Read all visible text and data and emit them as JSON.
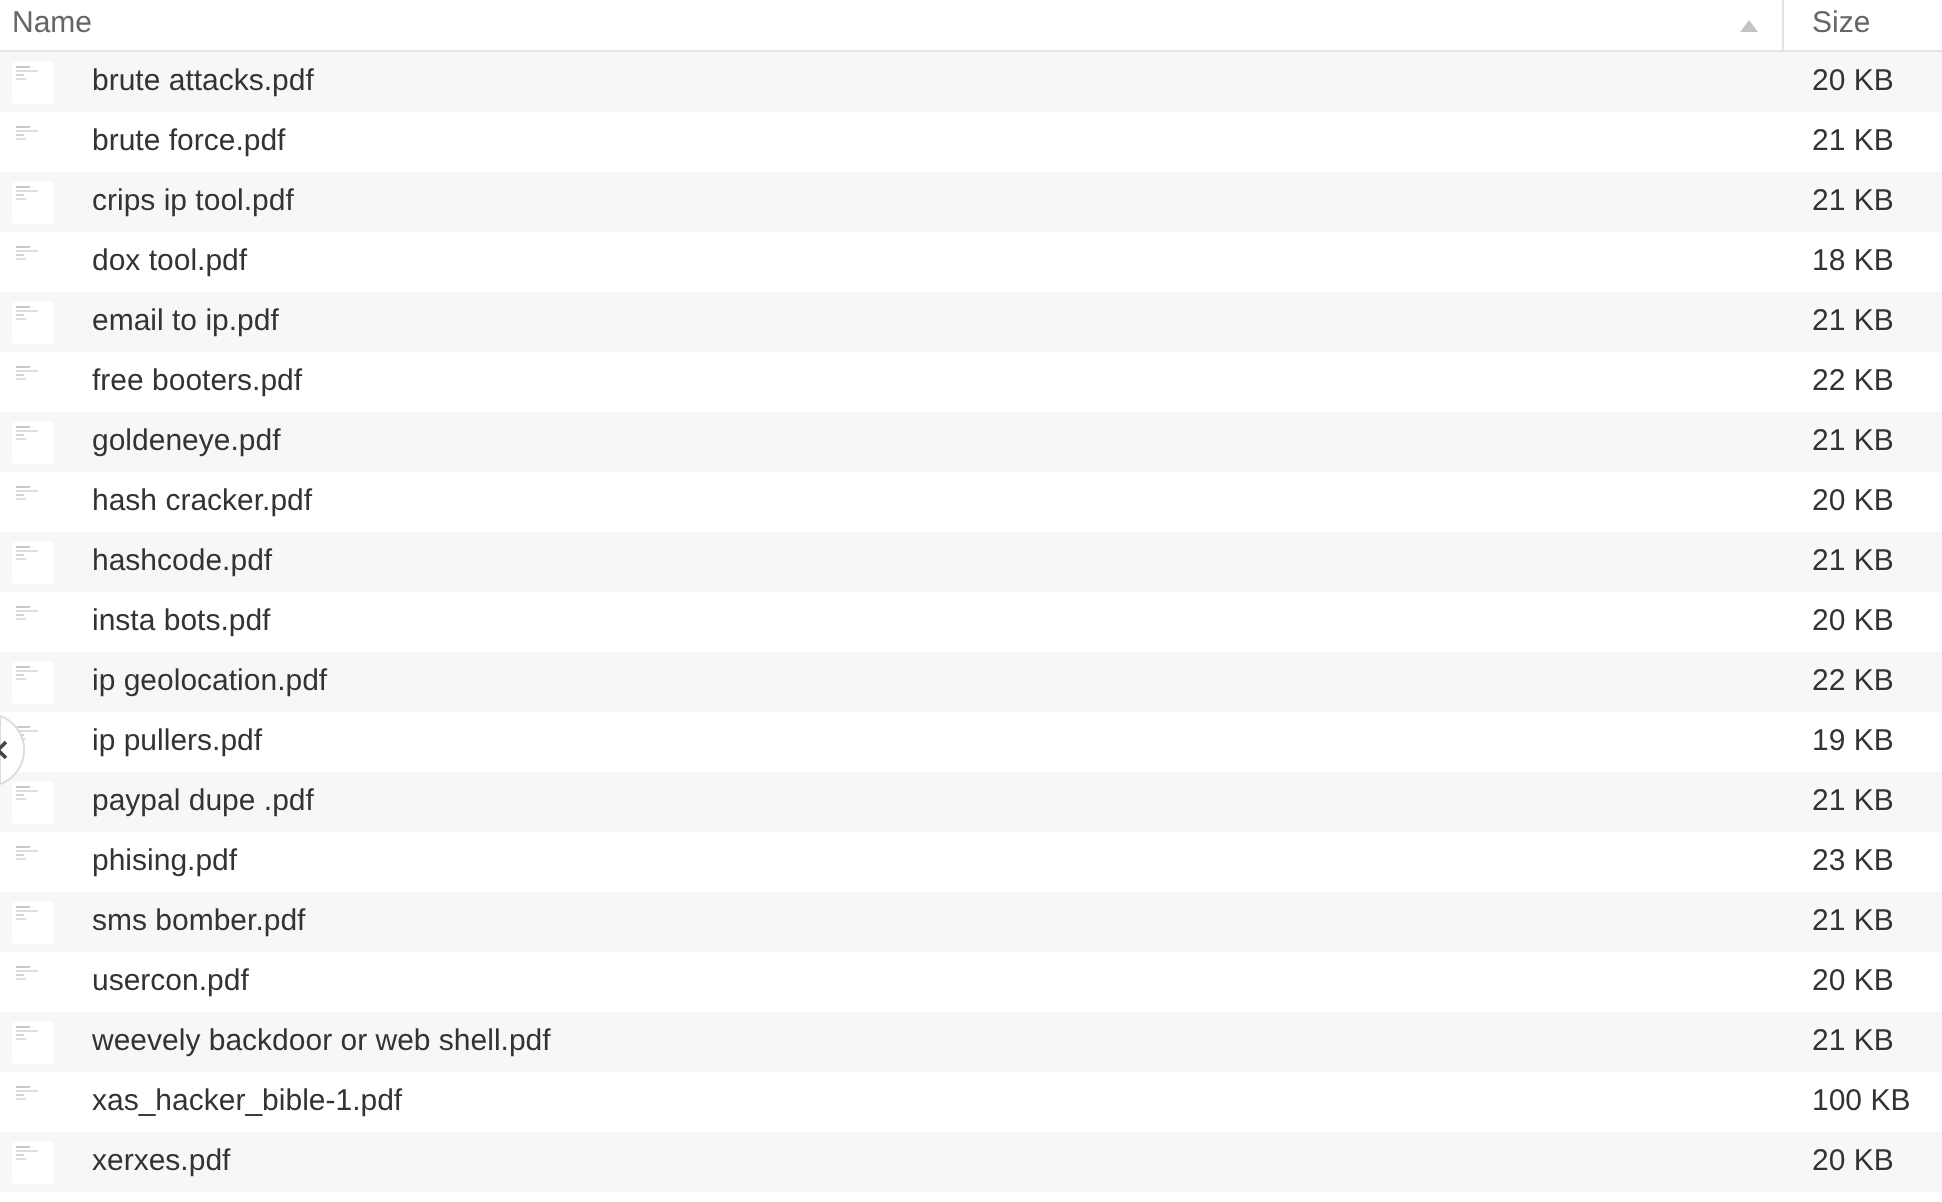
{
  "columns": [
    {
      "label": "Name",
      "sorted": true
    },
    {
      "label": "Size",
      "sorted": false
    }
  ],
  "rows": [
    {
      "name": "brute attacks.pdf",
      "size": "20 KB"
    },
    {
      "name": "brute force.pdf",
      "size": "21 KB"
    },
    {
      "name": "crips ip tool.pdf",
      "size": "21 KB"
    },
    {
      "name": "dox tool.pdf",
      "size": "18 KB"
    },
    {
      "name": "email to ip.pdf",
      "size": "21 KB"
    },
    {
      "name": "free booters.pdf",
      "size": "22 KB"
    },
    {
      "name": "goldeneye.pdf",
      "size": "21 KB"
    },
    {
      "name": "hash cracker.pdf",
      "size": "20 KB"
    },
    {
      "name": "hashcode.pdf",
      "size": "21 KB"
    },
    {
      "name": "insta bots.pdf",
      "size": "20 KB"
    },
    {
      "name": "ip geolocation.pdf",
      "size": "22 KB"
    },
    {
      "name": "ip pullers.pdf",
      "size": "19 KB"
    },
    {
      "name": "paypal dupe .pdf",
      "size": "21 KB"
    },
    {
      "name": "phising.pdf",
      "size": "23 KB"
    },
    {
      "name": "sms bomber.pdf",
      "size": "21 KB"
    },
    {
      "name": "usercon.pdf",
      "size": "20 KB"
    },
    {
      "name": "weevely backdoor or web shell.pdf",
      "size": "21 KB"
    },
    {
      "name": "xas_hacker_bible-1.pdf",
      "size": "100 KB"
    },
    {
      "name": "xerxes.pdf",
      "size": "20 KB"
    }
  ]
}
